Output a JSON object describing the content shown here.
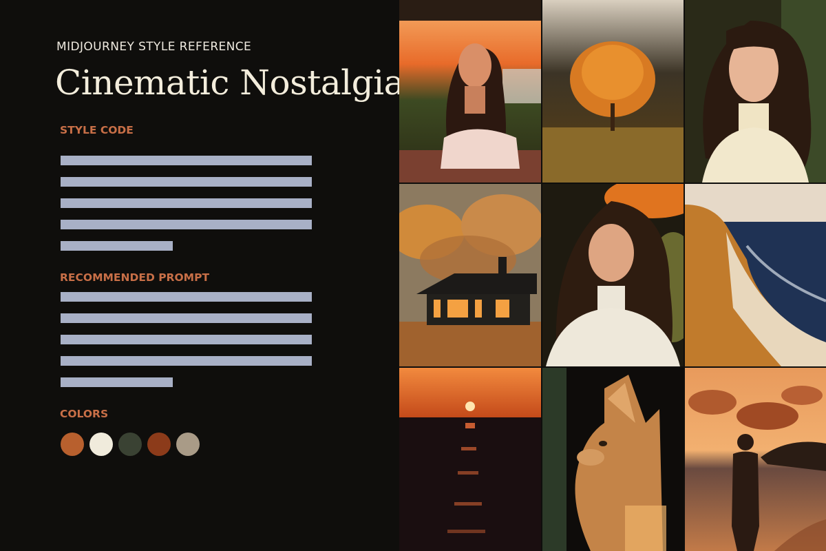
{
  "header": {
    "subtitle": "MIDJOURNEY STYLE REFERENCE",
    "title": "Cinematic Nostalgia"
  },
  "sections": {
    "style_code_label": "STYLE CODE",
    "prompt_label": "RECOMMENDED PROMPT",
    "colors_label": "COLORS"
  },
  "palette": [
    "#b8602e",
    "#f0ebdc",
    "#3a4233",
    "#8c3b1a",
    "#a99b87"
  ],
  "gallery": [
    {
      "name": "photo-woman-sunset-porch",
      "icon": "portrait-photo"
    },
    {
      "name": "photo-autumn-tree-field",
      "icon": "landscape-photo"
    },
    {
      "name": "photo-woman-turtleneck-closeup",
      "icon": "portrait-photo"
    },
    {
      "name": "photo-cabin-autumn-forest",
      "icon": "landscape-photo"
    },
    {
      "name": "photo-woman-white-sweater",
      "icon": "portrait-photo"
    },
    {
      "name": "photo-beach-coastline",
      "icon": "landscape-photo"
    },
    {
      "name": "photo-ocean-sunset",
      "icon": "landscape-photo"
    },
    {
      "name": "photo-cat-profile",
      "icon": "animal-photo"
    },
    {
      "name": "photo-silhouette-beach-sunset",
      "icon": "landscape-photo"
    }
  ]
}
